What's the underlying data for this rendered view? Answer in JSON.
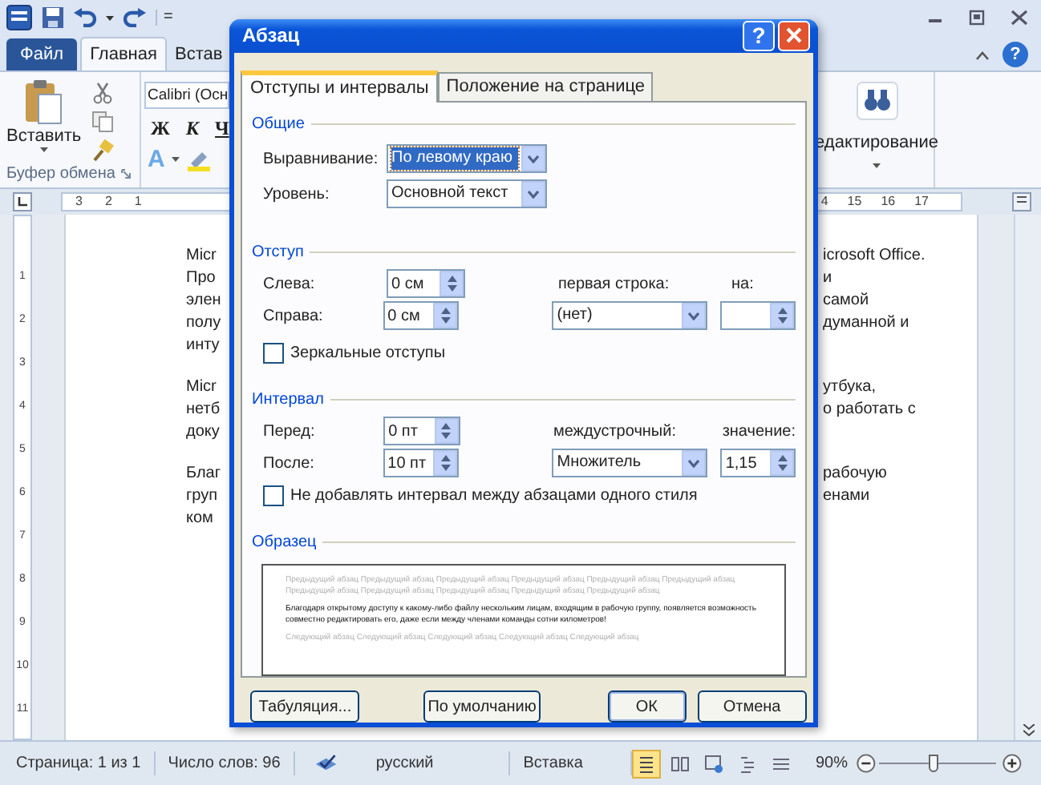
{
  "quick_access": {
    "customize_glyph": "="
  },
  "ribbon_tabs": [
    {
      "label": "Файл",
      "kind": "file",
      "selected": false
    },
    {
      "label": "Главная",
      "kind": "tab",
      "selected": true
    },
    {
      "label": "Встав",
      "kind": "tab",
      "selected": false
    }
  ],
  "ribbon_help_glyph": "?",
  "clipboard_group": {
    "paste_label": "Вставить",
    "group_label": "Буфер обмена"
  },
  "font_group": {
    "font_name": "Calibri (Осн",
    "bold": "Ж",
    "italic": "К",
    "underline": "Ч",
    "text_effects": "A"
  },
  "editing_group": {
    "label": "едактирование"
  },
  "ruler": {
    "left_ticks": [
      "3",
      "2",
      "1"
    ],
    "right_ticks": [
      "4",
      "15",
      "16",
      "17"
    ],
    "vertical_ticks": [
      "1",
      "2",
      "3",
      "4",
      "5",
      "6",
      "7",
      "8",
      "9",
      "10",
      "11"
    ]
  },
  "document": {
    "paragraphs": [
      {
        "lines": [
          {
            "left": "Micr",
            "right": "icrosoft Office."
          },
          {
            "left": "Про",
            "right": "и"
          },
          {
            "left": "элен",
            "right": "самой"
          },
          {
            "left": "полу",
            "right": "думанной и"
          },
          {
            "left": "инту"
          }
        ]
      },
      {
        "lines": [
          {
            "left": "Micr",
            "right": "утбука,"
          },
          {
            "left": "нетб",
            "right": "о работать с"
          },
          {
            "left": "доку"
          }
        ]
      },
      {
        "lines": [
          {
            "left": "Благ",
            "right": "рабочую"
          },
          {
            "left": "груп",
            "right": "енами"
          },
          {
            "left": "ком"
          }
        ]
      }
    ]
  },
  "dialog": {
    "title": "Абзац",
    "help_glyph": "?",
    "tabs": [
      {
        "label": "Отступы и интервалы",
        "selected": true
      },
      {
        "label": "Положение на странице",
        "selected": false
      }
    ],
    "general": {
      "heading": "Общие",
      "fields": [
        {
          "label": "Выравнивание:",
          "value": "По левому краю",
          "focused": true
        },
        {
          "label": "Уровень:",
          "value": "Основной текст",
          "focused": false
        }
      ]
    },
    "indent": {
      "heading": "Отступ",
      "left_label": "Слева:",
      "left_value": "0 см",
      "right_label": "Справа:",
      "right_value": "0 см",
      "first_line_label": "первая строка:",
      "first_line_value": "(нет)",
      "by_label": "на:",
      "mirror": {
        "label": "Зеркальные отступы",
        "checked": false
      }
    },
    "spacing": {
      "heading": "Интервал",
      "before_label": "Перед:",
      "before_value": "0 пт",
      "after_label": "После:",
      "after_value": "10 пт",
      "line_label": "междустрочный:",
      "line_value": "Множитель",
      "at_label": "значение:",
      "at_value": "1,15",
      "dont_add": {
        "label": "Не добавлять интервал между абзацами одного стиля",
        "checked": false
      }
    },
    "preview": {
      "heading": "Образец",
      "previous": "Предыдущий абзац Предыдущий абзац Предыдущий абзац Предыдущий абзац Предыдущий абзац Предыдущий абзац Предыдущий абзац Предыдущий абзац Предыдущий абзац Предыдущий абзац Предыдущий абзац",
      "current": "Благодаря открытому доступу к какому-либо файлу нескольким лицам, входящим в рабочую группу, появляется возможность совместно редактировать его, даже если между членами команды сотни километров!",
      "next": "Следующий абзац Следующий абзац Следующий абзац Следующий абзац Следующий абзац"
    },
    "buttons": [
      {
        "label": "Табуляция...",
        "default": false
      },
      {
        "label": "По умолчанию",
        "default": false
      },
      {
        "label": "ОК",
        "default": true
      },
      {
        "label": "Отмена",
        "default": false
      }
    ]
  },
  "status_bar": {
    "page": "Страница: 1 из 1",
    "words": "Число слов: 96",
    "language": "русский",
    "mode": "Вставка",
    "zoom": "90%",
    "zoom_slider": {
      "level": 0.42
    },
    "views": [
      {
        "selected": true
      },
      {
        "selected": false
      },
      {
        "selected": false
      },
      {
        "selected": false
      },
      {
        "selected": false
      }
    ]
  }
}
